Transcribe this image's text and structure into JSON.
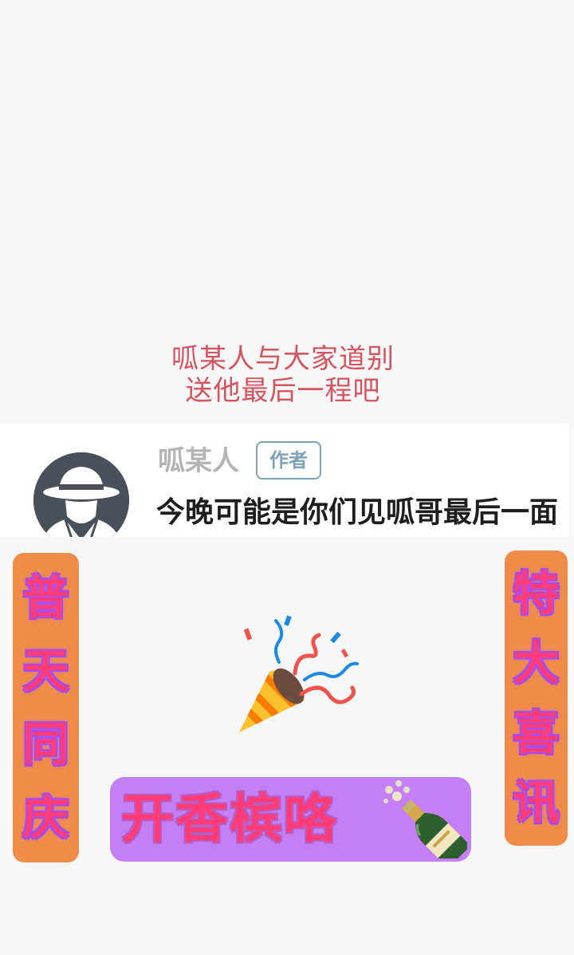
{
  "caption": {
    "line1": "呱某人与大家道别",
    "line2": "送他最后一程吧"
  },
  "comment": {
    "username": "呱某人",
    "badge": "作者",
    "text": "今晚可能是你们见呱哥最后一面"
  },
  "left_banner": [
    "普",
    "天",
    "同",
    "庆"
  ],
  "right_banner": [
    "特",
    "大",
    "喜",
    "讯"
  ],
  "bottom_banner": {
    "text": "开香槟咯"
  },
  "icons": {
    "avatar": "detective-avatar",
    "party": "party-popper-icon",
    "bottle": "champagne-bottle-icon"
  },
  "colors": {
    "caption": "#d4545f",
    "banner_bg": "#f08c4a",
    "banner_text": "#ff3c78",
    "champagne_bg": "#c47ff4",
    "badge": "#7ea3b7"
  }
}
